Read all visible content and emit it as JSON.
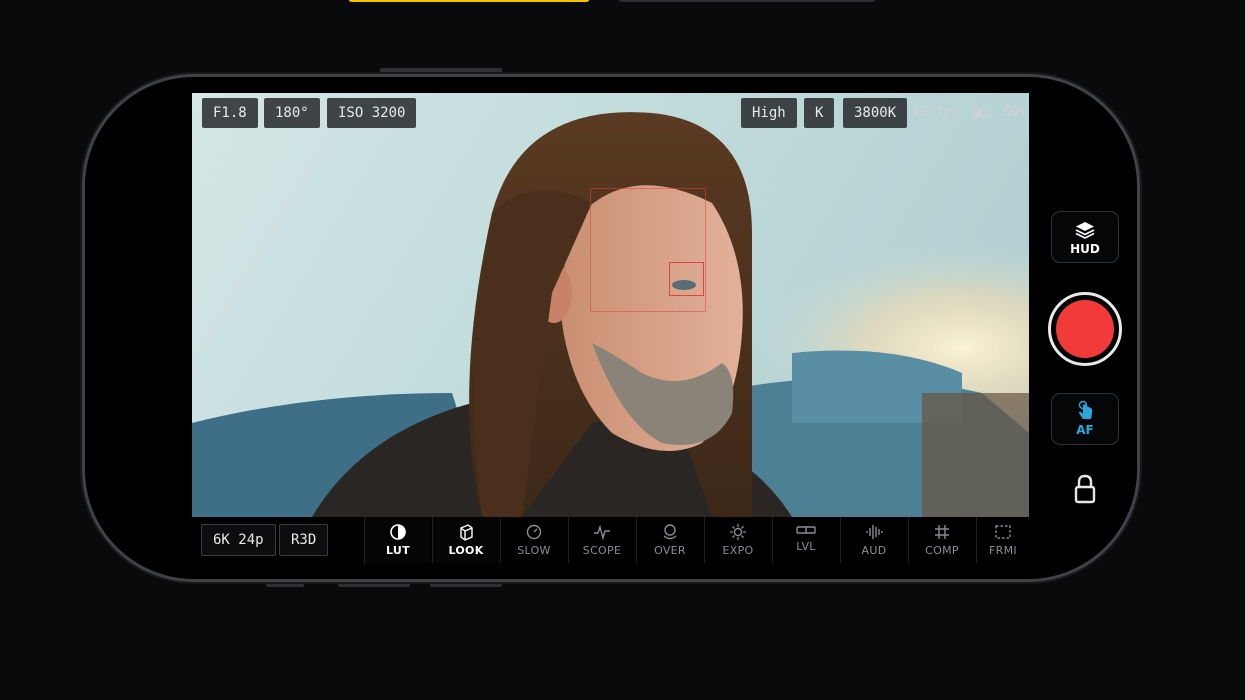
{
  "hud_top_left": [
    "F1.8",
    "180°",
    "ISO 3200"
  ],
  "hud_top_right": [
    "High",
    "K",
    "3800K"
  ],
  "status": {
    "fps": "49 fps",
    "battery": "60%",
    "battery_level": 0.6
  },
  "format": {
    "resolution": "6K 24p",
    "codec": "R3D"
  },
  "tools": [
    {
      "label": "LUT",
      "icon": "lut-icon",
      "active": true
    },
    {
      "label": "LOOK",
      "icon": "look-cube-icon",
      "active": true
    },
    {
      "label": "SLOW",
      "icon": "slow-gauge-icon",
      "active": false
    },
    {
      "label": "SCOPE",
      "icon": "scope-waveform-icon",
      "active": false
    },
    {
      "label": "OVER",
      "icon": "overlay-icon",
      "active": false
    },
    {
      "label": "EXPO",
      "icon": "exposure-sun-icon",
      "active": false
    },
    {
      "label": "LVL",
      "icon": "level-icon",
      "active": false
    },
    {
      "label": "AUD",
      "icon": "audio-waveform-icon",
      "active": false
    },
    {
      "label": "COMP",
      "icon": "composition-grid-icon",
      "active": false
    },
    {
      "label": "FRMI",
      "icon": "frame-guide-icon",
      "active": false
    }
  ],
  "side": {
    "hud_label": "HUD",
    "af_label": "AF"
  },
  "colors": {
    "accent": "#29a8e0",
    "record": "#f23a3a",
    "focus": "#e0443a",
    "pill_yellow": "#f5c400"
  }
}
